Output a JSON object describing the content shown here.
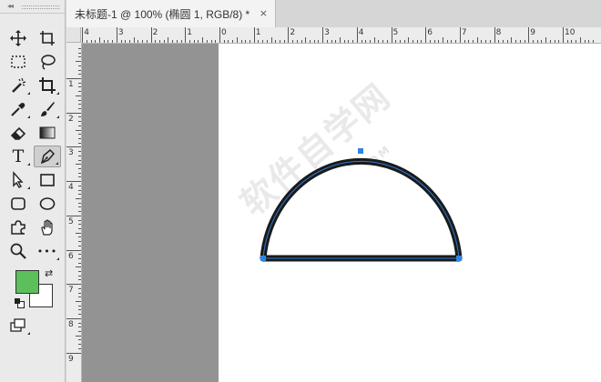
{
  "document_tab": {
    "title": "未标题-1 @ 100% (椭圆 1, RGB/8) *",
    "close_glyph": "×"
  },
  "toolbar": {
    "collapse_glyph": "◂◂",
    "tools": [
      {
        "name": "move-tool",
        "icon": "move-icon"
      },
      {
        "name": "artboard-tool",
        "icon": "artboard-icon"
      },
      {
        "name": "marquee-tool",
        "icon": "rect-marquee-icon"
      },
      {
        "name": "lasso-tool",
        "icon": "lasso-icon"
      },
      {
        "name": "magic-wand-tool",
        "icon": "magic-wand-icon"
      },
      {
        "name": "crop-tool",
        "icon": "crop-icon"
      },
      {
        "name": "eyedropper-tool",
        "icon": "eyedropper-icon"
      },
      {
        "name": "brush-tool",
        "icon": "brush-icon"
      },
      {
        "name": "eraser-tool",
        "icon": "eraser-icon"
      },
      {
        "name": "gradient-tool",
        "icon": "gradient-icon"
      },
      {
        "name": "type-tool",
        "icon": "type-icon",
        "label": "T"
      },
      {
        "name": "pen-tool",
        "icon": "pen-icon",
        "active": true
      },
      {
        "name": "path-selection-tool",
        "icon": "arrow-icon"
      },
      {
        "name": "rectangle-tool",
        "icon": "rectangle-icon"
      },
      {
        "name": "rounded-rect-tool",
        "icon": "rounded-rect-icon"
      },
      {
        "name": "ellipse-tool",
        "icon": "ellipse-icon"
      },
      {
        "name": "custom-shape-tool",
        "icon": "puzzle-icon"
      },
      {
        "name": "hand-tool",
        "icon": "hand-icon"
      },
      {
        "name": "zoom-tool",
        "icon": "zoom-icon"
      },
      {
        "name": "more-tools",
        "icon": "ellipsis-icon",
        "label": "•••"
      }
    ],
    "foreground_color": "#5cbf5c",
    "background_color": "#ffffff"
  },
  "ruler_top": {
    "labels": [
      "4",
      "3",
      "2",
      "1",
      "0",
      "1",
      "2",
      "3",
      "4",
      "5",
      "6",
      "7",
      "8",
      "9",
      "10"
    ]
  },
  "ruler_left": {
    "labels": [
      "1",
      "2",
      "3",
      "4",
      "5",
      "6",
      "7",
      "8",
      "9"
    ]
  },
  "watermark": {
    "text": "软件自学网",
    "sub": "WWW.RJZXW.COM"
  },
  "colors": {
    "shape_stroke": "#1a1a1a",
    "path_outline": "#2e7bd6",
    "anchor": "#2e86e0",
    "pasteboard": "#939393"
  }
}
